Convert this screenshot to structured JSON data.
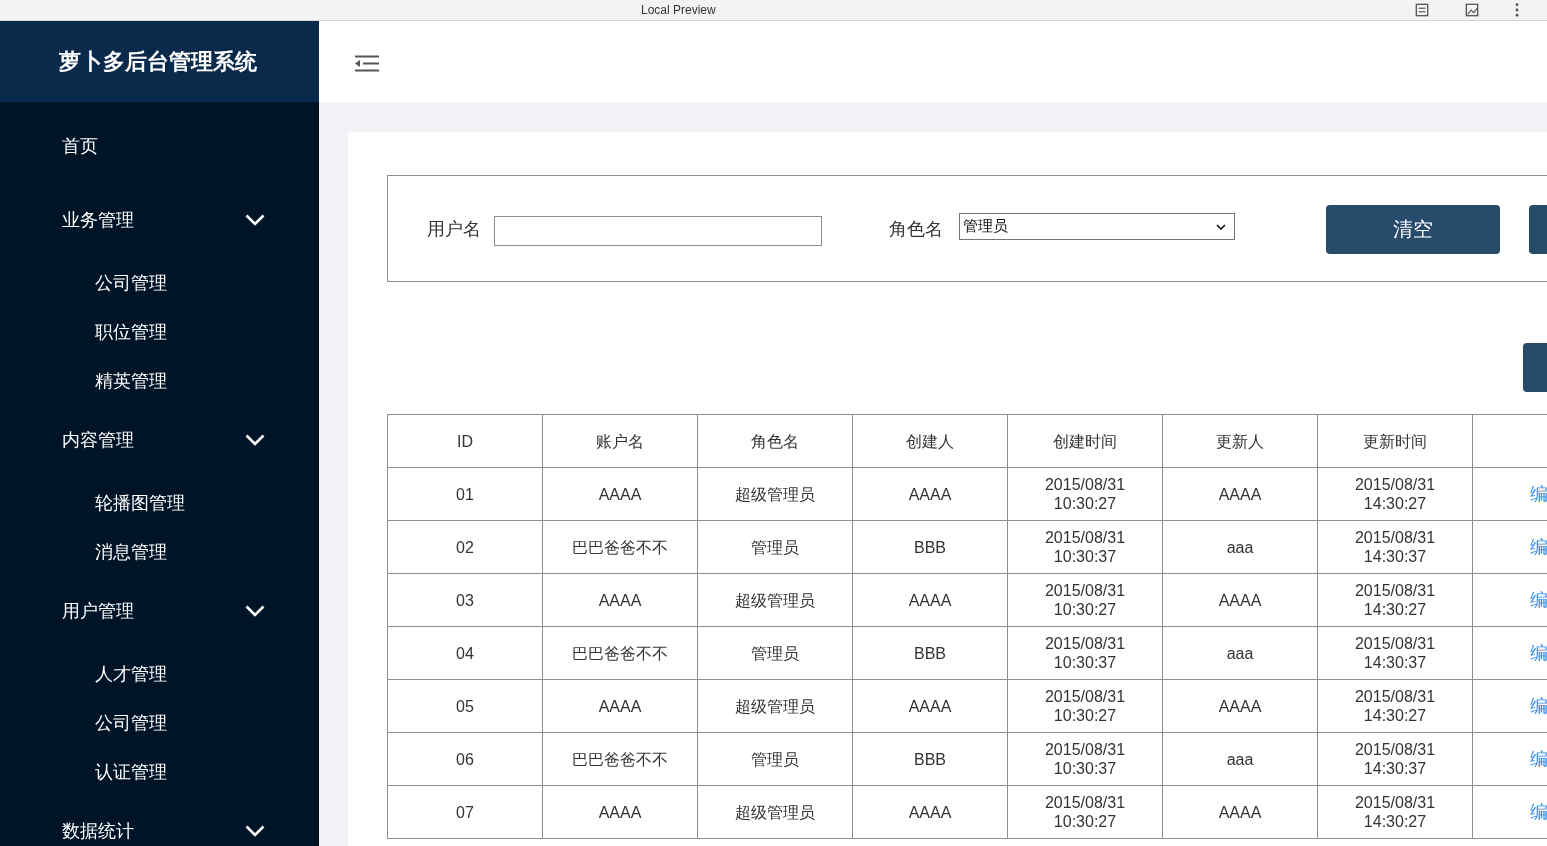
{
  "browser": {
    "title": "Local Preview"
  },
  "sidebar": {
    "title": "萝卜多后台管理系统",
    "items": [
      {
        "label": "首页",
        "kind": "link"
      },
      {
        "label": "业务管理",
        "kind": "group",
        "expanded": true,
        "children": [
          {
            "label": "公司管理"
          },
          {
            "label": "职位管理"
          },
          {
            "label": "精英管理"
          }
        ]
      },
      {
        "label": "内容管理",
        "kind": "group",
        "expanded": true,
        "children": [
          {
            "label": "轮播图管理"
          },
          {
            "label": "消息管理"
          }
        ]
      },
      {
        "label": "用户管理",
        "kind": "group",
        "expanded": true,
        "children": [
          {
            "label": "人才管理"
          },
          {
            "label": "公司管理"
          },
          {
            "label": "认证管理"
          }
        ]
      },
      {
        "label": "数据统计",
        "kind": "group",
        "expanded": true
      }
    ]
  },
  "filter": {
    "fields": [
      {
        "label": "用户名",
        "kind": "text"
      },
      {
        "label": "角色名",
        "kind": "select",
        "value": "管理员"
      }
    ],
    "buttons": [
      {
        "label": "清空"
      }
    ]
  },
  "table": {
    "columns": [
      "ID",
      "账户名",
      "角色名",
      "创建人",
      "创建时间",
      "更新人",
      "更新时间"
    ],
    "rows": [
      {
        "cells": [
          "01",
          "AAAA",
          "超级管理员",
          "AAAA",
          "2015/08/31\n10:30:27",
          "AAAA",
          "2015/08/31\n14:30:27"
        ],
        "action": "编"
      },
      {
        "cells": [
          "02",
          "巴巴爸爸不不",
          "管理员",
          "BBB",
          "2015/08/31\n10:30:37",
          "aaa",
          "2015/08/31\n14:30:37"
        ],
        "action": "编"
      },
      {
        "cells": [
          "03",
          "AAAA",
          "超级管理员",
          "AAAA",
          "2015/08/31\n10:30:27",
          "AAAA",
          "2015/08/31\n14:30:27"
        ],
        "action": "编"
      },
      {
        "cells": [
          "04",
          "巴巴爸爸不不",
          "管理员",
          "BBB",
          "2015/08/31\n10:30:37",
          "aaa",
          "2015/08/31\n14:30:37"
        ],
        "action": "编"
      },
      {
        "cells": [
          "05",
          "AAAA",
          "超级管理员",
          "AAAA",
          "2015/08/31\n10:30:27",
          "AAAA",
          "2015/08/31\n14:30:27"
        ],
        "action": "编"
      },
      {
        "cells": [
          "06",
          "巴巴爸爸不不",
          "管理员",
          "BBB",
          "2015/08/31\n10:30:37",
          "aaa",
          "2015/08/31\n14:30:37"
        ],
        "action": "编"
      },
      {
        "cells": [
          "07",
          "AAAA",
          "超级管理员",
          "AAAA",
          "2015/08/31\n10:30:27",
          "AAAA",
          "2015/08/31\n14:30:27"
        ],
        "action": "编"
      }
    ]
  }
}
